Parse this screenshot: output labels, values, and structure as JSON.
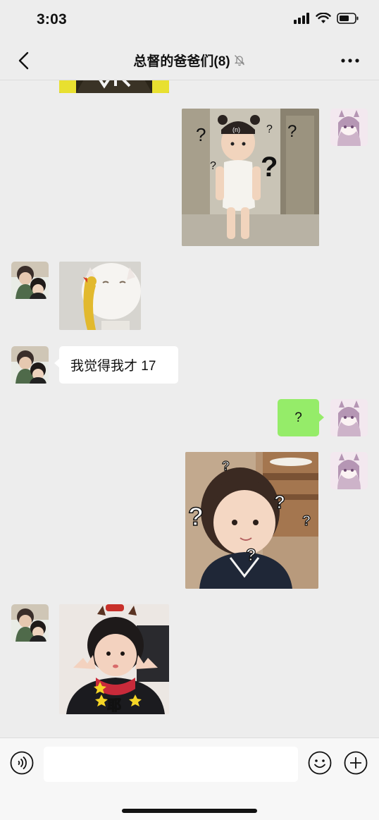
{
  "status_bar": {
    "time": "3:03"
  },
  "header": {
    "title": "总督的爸爸们(8)"
  },
  "messages": {
    "text_left": "我觉得我才 17",
    "text_right": "?"
  },
  "sticker_captions": {
    "ye": "耶"
  },
  "input": {
    "placeholder": ""
  },
  "colors": {
    "background": "#ededed",
    "outgoing_bubble": "#95ec69",
    "incoming_bubble": "#ffffff"
  },
  "icons": [
    "signal-icon",
    "wifi-icon",
    "battery-icon",
    "back-arrow-icon",
    "mute-bell-icon",
    "more-icon",
    "voice-icon",
    "emoji-icon",
    "plus-icon"
  ]
}
